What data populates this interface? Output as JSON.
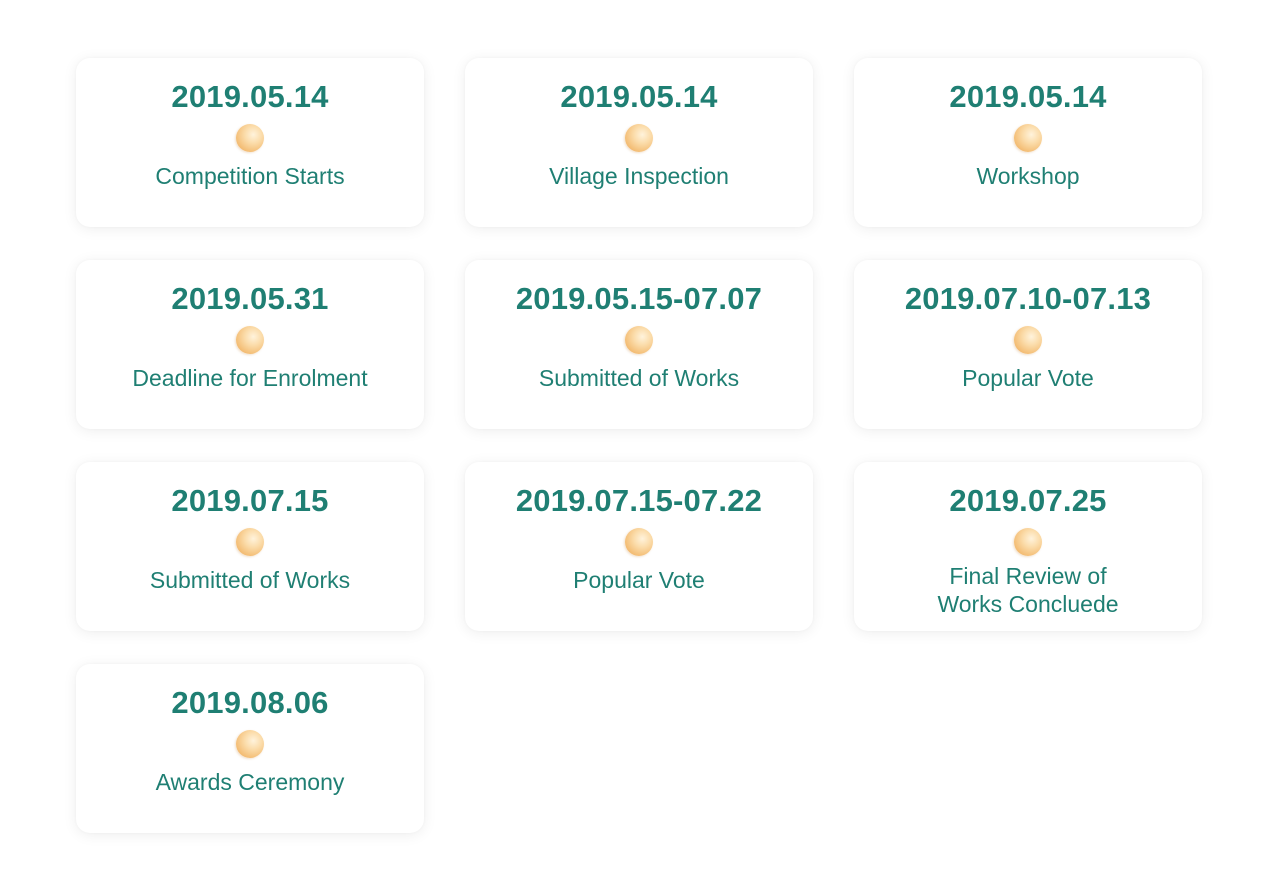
{
  "schedule": {
    "items": [
      {
        "date": "2019.05.14",
        "label": "Competition Starts"
      },
      {
        "date": "2019.05.14",
        "label": "Village Inspection"
      },
      {
        "date": "2019.05.14",
        "label": "Workshop"
      },
      {
        "date": "2019.05.31",
        "label": "Deadline for Enrolment"
      },
      {
        "date": "2019.05.15-07.07",
        "label": "Submitted of Works"
      },
      {
        "date": "2019.07.10-07.13",
        "label": "Popular Vote"
      },
      {
        "date": "2019.07.15",
        "label": "Submitted of Works"
      },
      {
        "date": "2019.07.15-07.22",
        "label": "Popular Vote"
      },
      {
        "date": "2019.07.25",
        "label": "Final Review of Works Concluede"
      },
      {
        "date": "2019.08.06",
        "label": "Awards Ceremony"
      }
    ]
  },
  "colors": {
    "text": "#1f7f73",
    "card_background": "#ffffff",
    "dot": "#f4bf78"
  },
  "icons": {
    "marker": "orange-dot-icon"
  }
}
